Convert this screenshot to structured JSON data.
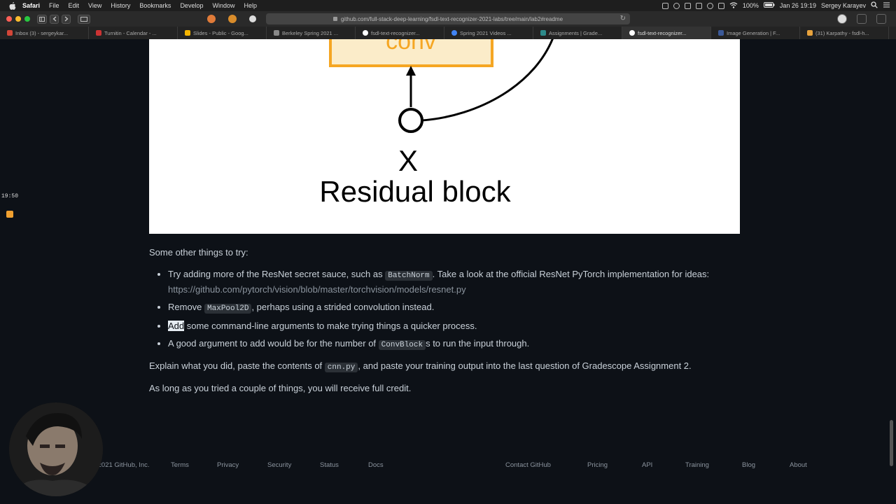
{
  "menubar": {
    "app": "Safari",
    "items": [
      "File",
      "Edit",
      "View",
      "History",
      "Bookmarks",
      "Develop",
      "Window",
      "Help"
    ],
    "battery": "100%",
    "datetime": "Jan 26  19:19",
    "user": "Sergey Karayev"
  },
  "browser": {
    "url": "github.com/full-stack-deep-learning/fsdl-text-recognizer-2021-labs/tree/main/lab2#readme",
    "tabs": [
      {
        "label": "Inbox (3) - sergeykar..."
      },
      {
        "label": "Turnitin - Calendar - ..."
      },
      {
        "label": "Slides - Public - Goog..."
      },
      {
        "label": "Berkeley Spring 2021 ..."
      },
      {
        "label": "fsdl-text-recognizer..."
      },
      {
        "label": "Spring 2021 Videos ..."
      },
      {
        "label": "Assignments | Grade..."
      },
      {
        "label": "fsdl-text-recognizer..."
      },
      {
        "label": "Image Generation | F..."
      },
      {
        "label": "(31) Karpathy - fsdl-h..."
      }
    ],
    "active_tab_index": 7
  },
  "diagram": {
    "box_label": "conv",
    "input_label": "X",
    "caption": "Residual block",
    "box_color": "#f5a623"
  },
  "content": {
    "intro": "Some other things to try:",
    "bullets": [
      {
        "pre": "Try adding more of the ResNet secret sauce, such as ",
        "code": "BatchNorm",
        "post": ". Take a look at the official ResNet PyTorch implementation for ideas:",
        "url": "https://github.com/pytorch/vision/blob/master/torchvision/models/resnet.py"
      },
      {
        "pre": "Remove ",
        "code": "MaxPool2D",
        "post": ", perhaps using a strided convolution instead."
      },
      {
        "selected": "Add",
        "post": " some command-line arguments to make trying things a quicker process."
      },
      {
        "pre": "A good argument to add would be for the number of ",
        "code": "ConvBlock",
        "post": "s to run the input through."
      }
    ],
    "explain_pre": "Explain what you did, paste the contents of ",
    "explain_code": "cnn.py",
    "explain_post": ", and paste your training output into the last question of Gradescope Assignment 2.",
    "final": "As long as you tried a couple of things, you will receive full credit."
  },
  "footer": {
    "copyright": "© 2021 GitHub, Inc.",
    "links": [
      "Terms",
      "Privacy",
      "Security",
      "Status",
      "Docs",
      "Contact GitHub",
      "Pricing",
      "API",
      "Training",
      "Blog",
      "About"
    ]
  },
  "overlay": {
    "clock": "19:50"
  }
}
